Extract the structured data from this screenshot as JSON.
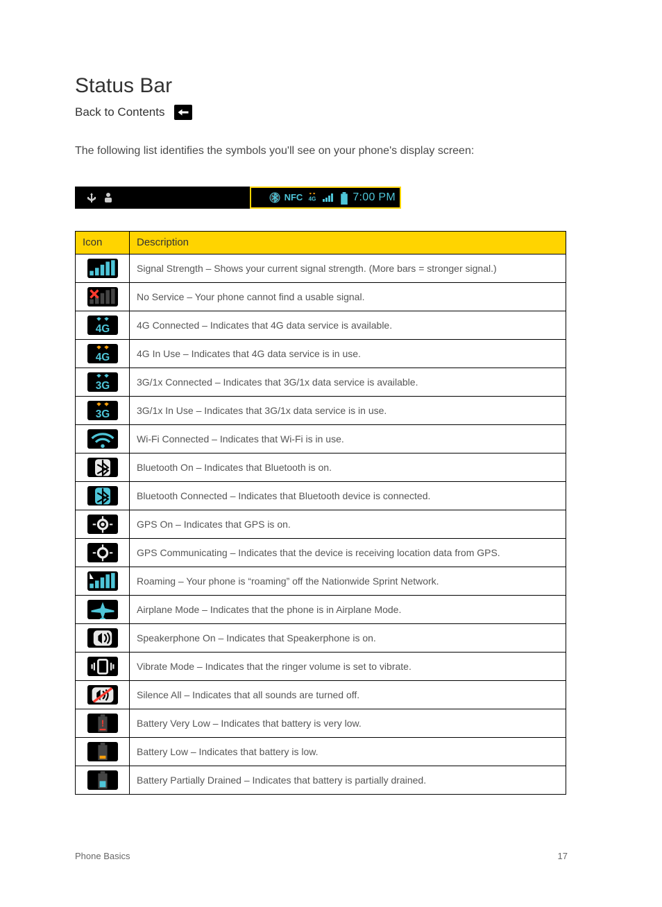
{
  "page": {
    "title": "Status Bar",
    "back_label": "Back to Contents",
    "intro": "The following list identifies the symbols you'll see on your phone's display screen:",
    "table_headers": {
      "icon": "Icon",
      "desc": "Description"
    },
    "status_bar_time": "7:00 PM",
    "footer_left": "Phone Basics",
    "footer_right": "17"
  },
  "rows": [
    {
      "name": "signal-strength-icon",
      "desc": "Signal Strength – Shows your current signal strength. (More bars = stronger signal.)"
    },
    {
      "name": "no-service-icon",
      "desc": "No Service – Your phone cannot find a usable signal."
    },
    {
      "name": "4g-connected-icon",
      "desc": "4G Connected – Indicates that 4G data service is available."
    },
    {
      "name": "4g-in-use-icon",
      "desc": "4G In Use – Indicates that 4G data service is in use."
    },
    {
      "name": "3g-connected-icon",
      "desc": "3G/1x Connected – Indicates that 3G/1x data service is available."
    },
    {
      "name": "3g-in-use-icon",
      "desc": "3G/1x In Use – Indicates that 3G/1x data service is in use."
    },
    {
      "name": "wifi-connected-icon",
      "desc": "Wi-Fi Connected – Indicates that Wi-Fi is in use."
    },
    {
      "name": "bluetooth-on-icon",
      "desc": "Bluetooth On – Indicates that Bluetooth is on."
    },
    {
      "name": "bluetooth-connected-icon",
      "desc": "Bluetooth Connected – Indicates that Bluetooth device is connected."
    },
    {
      "name": "gps-on-icon",
      "desc": "GPS On – Indicates that GPS is on."
    },
    {
      "name": "gps-communicating-icon",
      "desc": "GPS Communicating – Indicates that the device is receiving location data from GPS."
    },
    {
      "name": "roaming-icon",
      "desc": "Roaming – Your phone is “roaming” off the Nationwide Sprint Network."
    },
    {
      "name": "airplane-mode-icon",
      "desc": "Airplane Mode – Indicates that the phone is in Airplane Mode."
    },
    {
      "name": "speakerphone-on-icon",
      "desc": "Speakerphone On – Indicates that Speakerphone is on."
    },
    {
      "name": "vibrate-mode-icon",
      "desc": "Vibrate Mode – Indicates that the ringer volume is set to vibrate."
    },
    {
      "name": "silence-all-icon",
      "desc": "Silence All – Indicates that all sounds are turned off."
    },
    {
      "name": "battery-very-low-icon",
      "desc": "Battery Very Low – Indicates that battery is very low."
    },
    {
      "name": "battery-low-icon",
      "desc": "Battery Low – Indicates that battery is low."
    },
    {
      "name": "battery-drained-icon",
      "desc": "Battery Partially Drained – Indicates that battery is partially drained."
    }
  ],
  "icons": {
    "signal-strength-icon": "<svg viewBox='0 0 40 26'><path fill='#4ec5d8' d='M3 22h5v-6H3zM10 22h5V12h-5zM17 22h5V8h-5zM24 22h5V4h-5zM31 22h5V2h-5z'/></svg>",
    "no-service-icon": "<svg viewBox='0 0 40 26'><path fill='#444' d='M3 22h5v-6H3zM10 22h5V12h-5zM17 22h5V8h-5zM24 22h5V4h-5zM31 22h5V2h-5z'/><path stroke='#ff3b2f' stroke-width='3' d='M4 4l10 10M14 4L4 14'/></svg>",
    "4g-connected-icon": "<svg viewBox='0 0 40 26'><path fill='#4ec5d8' d='M12 4l3-2 3 2-3 3zM22 4l3-2 3 2-3 3z'/><text x='20' y='22' text-anchor='middle' fill='#4ec5d8' font-family='Arial' font-size='14' font-weight='bold'>4G</text></svg>",
    "4g-in-use-icon": "<svg viewBox='0 0 40 26'><path fill='#f59e0b' d='M12 4l3-2 3 2-3 3zM22 4l3-2 3 2-3 3z'/><text x='20' y='22' text-anchor='middle' fill='#4ec5d8' font-family='Arial' font-size='14' font-weight='bold'>4G</text></svg>",
    "3g-connected-icon": "<svg viewBox='0 0 40 26'><path fill='#4ec5d8' d='M12 4l3-2 3 2-3 3zM22 4l3-2 3 2-3 3z'/><text x='20' y='22' text-anchor='middle' fill='#4ec5d8' font-family='Arial' font-size='14' font-weight='bold'>3G</text></svg>",
    "3g-in-use-icon": "<svg viewBox='0 0 40 26'><path fill='#f59e0b' d='M12 4l3-2 3 2-3 3zM22 4l3-2 3 2-3 3z'/><text x='20' y='22' text-anchor='middle' fill='#4ec5d8' font-family='Arial' font-size='14' font-weight='bold'>3G</text></svg>",
    "wifi-connected-icon": "<svg viewBox='0 0 40 26'><path fill='none' stroke='#4ec5d8' stroke-width='3' d='M6 12a20 20 0 0128 0M11 17a12 12 0 0118 0'/><circle cx='20' cy='22' r='2.5' fill='#4ec5d8'/></svg>",
    "bluetooth-on-icon": "<svg viewBox='0 0 40 26'><rect x='10' y='2' width='20' height='22' rx='4' fill='#e8e8e8'/><path fill='none' stroke='#000' stroke-width='2' d='M20 3v20l7-6-14-8m0 12l14-8-7-6'/></svg>",
    "bluetooth-connected-icon": "<svg viewBox='0 0 40 26'><rect x='10' y='2' width='20' height='22' rx='4' fill='#4ec5d8'/><path fill='none' stroke='#000' stroke-width='2' d='M20 3v20l7-6-14-8m0 12l14-8-7-6'/></svg>",
    "gps-on-icon": "<svg viewBox='0 0 40 26'><circle cx='20' cy='13' r='6' fill='none' stroke='#e8e8e8' stroke-width='3'/><circle cx='20' cy='13' r='2.5' fill='#e8e8e8'/><path stroke='#e8e8e8' stroke-width='2' d='M20 2v4M20 20v4M7 13h4M29 13h4'/></svg>",
    "gps-communicating-icon": "<svg viewBox='0 0 40 26'><circle cx='20' cy='13' r='6' fill='none' stroke='#e8e8e8' stroke-width='3'/><path stroke='#e8e8e8' stroke-width='2' d='M20 2v4M20 20v4M7 13h4M29 13h4'/></svg>",
    "roaming-icon": "<svg viewBox='0 0 40 26'><path fill='#4ec5d8' d='M3 22h5v-6H3zM10 22h5V12h-5zM17 22h5V8h-5zM24 22h5V4h-5zM31 22h5V2h-5z'/><path fill='#fff' d='M3 2l5 8H3z'/></svg>",
    "airplane-mode-icon": "<svg viewBox='0 0 40 26'><path fill='#4ec5d8' d='M20 3l3 8 12 3v2l-12 1-2 6 3 2v1h-8v-1l3-2-2-6-12-1v-2l12-3z'/></svg>",
    "speakerphone-on-icon": "<svg viewBox='0 0 40 26'><rect x='8' y='3' width='24' height='20' rx='5' fill='#e8e8e8'/><path fill='#000' d='M14 10v6l5 4V6z'/><path fill='none' stroke='#000' stroke-width='2' d='M22 8a6 6 0 010 10M26 6a10 10 0 010 14'/></svg>",
    "vibrate-mode-icon": "<svg viewBox='0 0 40 26'><rect x='14' y='4' width='12' height='18' rx='2' fill='none' stroke='#e8e8e8' stroke-width='2.5'/><path stroke='#e8e8e8' stroke-width='2' d='M9 8v10M6 10v6M31 8v10M34 10v6'/></svg>",
    "silence-all-icon": "<svg viewBox='0 0 40 26'><rect x='6' y='3' width='28' height='20' rx='5' fill='#e8e8e8'/><path fill='#000' d='M12 10v6l5 4V6z'/><path fill='none' stroke='#000' stroke-width='2' d='M20 8a6 6 0 010 10M24 6a10 10 0 010 14'/><path stroke='#ff3b2f' stroke-width='3' d='M8 22L32 4'/></svg>",
    "battery-very-low-icon": "<svg viewBox='0 0 40 26'><rect x='14' y='4' width='12' height='20' fill='#444'/><rect x='17' y='1' width='6' height='3' fill='#444'/><rect x='16' y='20' width='8' height='2' fill='#ff3b2f'/><text x='20' y='17' text-anchor='middle' fill='#ff3b2f' font-family='Arial' font-size='12' font-weight='bold'>!</text></svg>",
    "battery-low-icon": "<svg viewBox='0 0 40 26'><rect x='14' y='4' width='12' height='20' fill='#444'/><rect x='17' y='1' width='6' height='3' fill='#444'/><rect x='16' y='18' width='8' height='4' fill='#f59e0b'/></svg>",
    "battery-drained-icon": "<svg viewBox='0 0 40 26'><rect x='14' y='4' width='12' height='20' fill='#444'/><rect x='17' y='1' width='6' height='3' fill='#444'/><rect x='16' y='14' width='8' height='8' fill='#4ec5d8'/></svg>"
  }
}
